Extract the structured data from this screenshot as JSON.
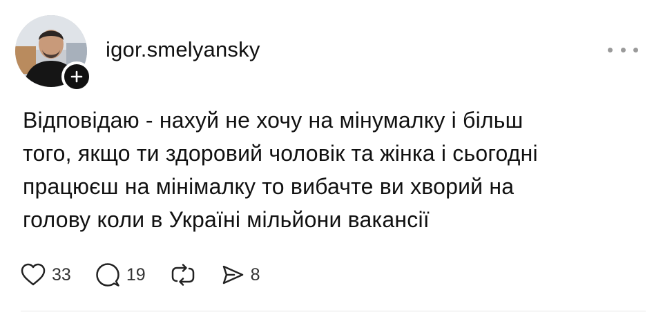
{
  "post": {
    "username": "igor.smelyansky",
    "text_lines": [
      "Відповідаю - нахуй не хочу на мінумалку і більш",
      "того, якщо ти здоровий чоловік та жінка і сьогодні",
      "працюєш на мінімалку то вибачте ви хворий на",
      "голову коли в Україні мільйони вакансії"
    ],
    "likes": "33",
    "replies": "19",
    "shares": "8"
  },
  "icons": {
    "follow": "plus-icon",
    "more": "more-dots-icon",
    "like": "heart-icon",
    "reply": "comment-icon",
    "repost": "repost-icon",
    "share": "send-icon"
  }
}
